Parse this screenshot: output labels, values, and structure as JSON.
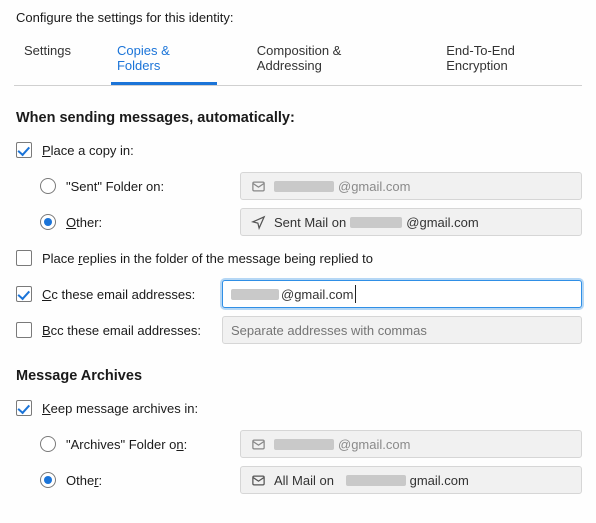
{
  "header": {
    "configure_text": "Configure the settings for this identity:"
  },
  "tabs": {
    "settings": "Settings",
    "copies": "Copies & Folders",
    "composition": "Composition & Addressing",
    "e2e": "End-To-End Encryption",
    "active": "copies"
  },
  "sending": {
    "section_title": "When sending messages, automatically:",
    "place_copy_label_pre": "",
    "place_copy_mnemonic": "P",
    "place_copy_label_post": "lace a copy in:",
    "place_copy_checked": true,
    "sent_folder_label": "\"Sent\" Folder on:",
    "sent_folder_selected": false,
    "sent_account_suffix": "@gmail.com",
    "other_mnemonic": "O",
    "other_label_post": "ther:",
    "other_selected": true,
    "other_value_pre": "Sent Mail on ",
    "other_value_suffix": "@gmail.com",
    "place_replies_mnemonic": "r",
    "place_replies_pre": "Place ",
    "place_replies_post": "eplies in the folder of the message being replied to",
    "place_replies_checked": false,
    "cc_mnemonic": "C",
    "cc_label_post": "c these email addresses:",
    "cc_checked": true,
    "cc_value_suffix": "@gmail.com",
    "bcc_mnemonic": "B",
    "bcc_label_post": "cc these email addresses:",
    "bcc_checked": false,
    "bcc_placeholder": "Separate addresses with commas"
  },
  "archives": {
    "section_title": "Message Archives",
    "keep_mnemonic": "K",
    "keep_label_post": "eep message archives in:",
    "keep_checked": true,
    "archives_folder_label_pre": "\"Archives\" Folder o",
    "archives_folder_mnemonic": "n",
    "archives_folder_label_post": ":",
    "archives_folder_selected": false,
    "archives_account_suffix": "@gmail.com",
    "other_label_pre": "Othe",
    "other_mnemonic": "r",
    "other_label_post": ":",
    "other_selected": true,
    "other_value_pre": "All Mail on",
    "other_value_suffix": "gmail.com"
  }
}
